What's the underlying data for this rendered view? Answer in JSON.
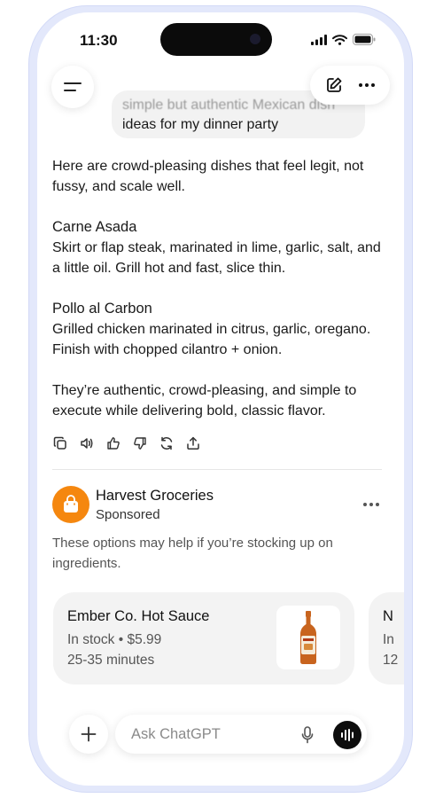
{
  "status_bar": {
    "time": "11:30"
  },
  "chat": {
    "user_message": {
      "faded_line": "simple but authentic Mexican dish",
      "visible_line": "ideas for my dinner party"
    },
    "assistant": {
      "intro": "Here are crowd-pleasing dishes that feel legit, not fussy, and scale well.",
      "items": [
        {
          "title": "Carne Asada",
          "body": "Skirt or flap steak, marinated in lime, garlic, salt, and a little oil. Grill hot and fast, slice thin."
        },
        {
          "title": "Pollo al Carbon",
          "body": "Grilled chicken marinated in citrus, garlic, oregano. Finish with chopped cilantro + onion."
        }
      ],
      "outro": "They’re authentic, crowd-pleasing, and simple to execute while delivering bold, classic flavor."
    },
    "action_icons": [
      "copy-icon",
      "speaker-icon",
      "thumbs-up-icon",
      "thumbs-down-icon",
      "regenerate-icon",
      "share-icon"
    ]
  },
  "sponsored": {
    "brand": "Harvest Groceries",
    "label": "Sponsored",
    "message": "These options may help if you’re stocking up on ingredients.",
    "accent_color": "#f5870f",
    "products": [
      {
        "name": "Ember Co. Hot Sauce",
        "stock": "In stock • $5.99",
        "eta": "25-35 minutes"
      },
      {
        "name": "N",
        "stock": "In",
        "eta": "12"
      }
    ]
  },
  "composer": {
    "placeholder": "Ask ChatGPT"
  }
}
